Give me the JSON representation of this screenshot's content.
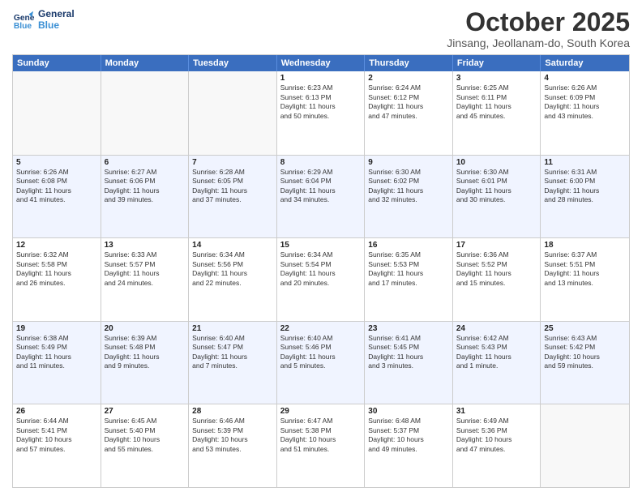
{
  "header": {
    "logo_line1": "General",
    "logo_line2": "Blue",
    "month_title": "October 2025",
    "location": "Jinsang, Jeollanam-do, South Korea"
  },
  "days_of_week": [
    "Sunday",
    "Monday",
    "Tuesday",
    "Wednesday",
    "Thursday",
    "Friday",
    "Saturday"
  ],
  "rows": [
    {
      "alt": false,
      "cells": [
        {
          "num": "",
          "text": ""
        },
        {
          "num": "",
          "text": ""
        },
        {
          "num": "",
          "text": ""
        },
        {
          "num": "1",
          "text": "Sunrise: 6:23 AM\nSunset: 6:13 PM\nDaylight: 11 hours\nand 50 minutes."
        },
        {
          "num": "2",
          "text": "Sunrise: 6:24 AM\nSunset: 6:12 PM\nDaylight: 11 hours\nand 47 minutes."
        },
        {
          "num": "3",
          "text": "Sunrise: 6:25 AM\nSunset: 6:11 PM\nDaylight: 11 hours\nand 45 minutes."
        },
        {
          "num": "4",
          "text": "Sunrise: 6:26 AM\nSunset: 6:09 PM\nDaylight: 11 hours\nand 43 minutes."
        }
      ]
    },
    {
      "alt": true,
      "cells": [
        {
          "num": "5",
          "text": "Sunrise: 6:26 AM\nSunset: 6:08 PM\nDaylight: 11 hours\nand 41 minutes."
        },
        {
          "num": "6",
          "text": "Sunrise: 6:27 AM\nSunset: 6:06 PM\nDaylight: 11 hours\nand 39 minutes."
        },
        {
          "num": "7",
          "text": "Sunrise: 6:28 AM\nSunset: 6:05 PM\nDaylight: 11 hours\nand 37 minutes."
        },
        {
          "num": "8",
          "text": "Sunrise: 6:29 AM\nSunset: 6:04 PM\nDaylight: 11 hours\nand 34 minutes."
        },
        {
          "num": "9",
          "text": "Sunrise: 6:30 AM\nSunset: 6:02 PM\nDaylight: 11 hours\nand 32 minutes."
        },
        {
          "num": "10",
          "text": "Sunrise: 6:30 AM\nSunset: 6:01 PM\nDaylight: 11 hours\nand 30 minutes."
        },
        {
          "num": "11",
          "text": "Sunrise: 6:31 AM\nSunset: 6:00 PM\nDaylight: 11 hours\nand 28 minutes."
        }
      ]
    },
    {
      "alt": false,
      "cells": [
        {
          "num": "12",
          "text": "Sunrise: 6:32 AM\nSunset: 5:58 PM\nDaylight: 11 hours\nand 26 minutes."
        },
        {
          "num": "13",
          "text": "Sunrise: 6:33 AM\nSunset: 5:57 PM\nDaylight: 11 hours\nand 24 minutes."
        },
        {
          "num": "14",
          "text": "Sunrise: 6:34 AM\nSunset: 5:56 PM\nDaylight: 11 hours\nand 22 minutes."
        },
        {
          "num": "15",
          "text": "Sunrise: 6:34 AM\nSunset: 5:54 PM\nDaylight: 11 hours\nand 20 minutes."
        },
        {
          "num": "16",
          "text": "Sunrise: 6:35 AM\nSunset: 5:53 PM\nDaylight: 11 hours\nand 17 minutes."
        },
        {
          "num": "17",
          "text": "Sunrise: 6:36 AM\nSunset: 5:52 PM\nDaylight: 11 hours\nand 15 minutes."
        },
        {
          "num": "18",
          "text": "Sunrise: 6:37 AM\nSunset: 5:51 PM\nDaylight: 11 hours\nand 13 minutes."
        }
      ]
    },
    {
      "alt": true,
      "cells": [
        {
          "num": "19",
          "text": "Sunrise: 6:38 AM\nSunset: 5:49 PM\nDaylight: 11 hours\nand 11 minutes."
        },
        {
          "num": "20",
          "text": "Sunrise: 6:39 AM\nSunset: 5:48 PM\nDaylight: 11 hours\nand 9 minutes."
        },
        {
          "num": "21",
          "text": "Sunrise: 6:40 AM\nSunset: 5:47 PM\nDaylight: 11 hours\nand 7 minutes."
        },
        {
          "num": "22",
          "text": "Sunrise: 6:40 AM\nSunset: 5:46 PM\nDaylight: 11 hours\nand 5 minutes."
        },
        {
          "num": "23",
          "text": "Sunrise: 6:41 AM\nSunset: 5:45 PM\nDaylight: 11 hours\nand 3 minutes."
        },
        {
          "num": "24",
          "text": "Sunrise: 6:42 AM\nSunset: 5:43 PM\nDaylight: 11 hours\nand 1 minute."
        },
        {
          "num": "25",
          "text": "Sunrise: 6:43 AM\nSunset: 5:42 PM\nDaylight: 10 hours\nand 59 minutes."
        }
      ]
    },
    {
      "alt": false,
      "cells": [
        {
          "num": "26",
          "text": "Sunrise: 6:44 AM\nSunset: 5:41 PM\nDaylight: 10 hours\nand 57 minutes."
        },
        {
          "num": "27",
          "text": "Sunrise: 6:45 AM\nSunset: 5:40 PM\nDaylight: 10 hours\nand 55 minutes."
        },
        {
          "num": "28",
          "text": "Sunrise: 6:46 AM\nSunset: 5:39 PM\nDaylight: 10 hours\nand 53 minutes."
        },
        {
          "num": "29",
          "text": "Sunrise: 6:47 AM\nSunset: 5:38 PM\nDaylight: 10 hours\nand 51 minutes."
        },
        {
          "num": "30",
          "text": "Sunrise: 6:48 AM\nSunset: 5:37 PM\nDaylight: 10 hours\nand 49 minutes."
        },
        {
          "num": "31",
          "text": "Sunrise: 6:49 AM\nSunset: 5:36 PM\nDaylight: 10 hours\nand 47 minutes."
        },
        {
          "num": "",
          "text": ""
        }
      ]
    }
  ]
}
